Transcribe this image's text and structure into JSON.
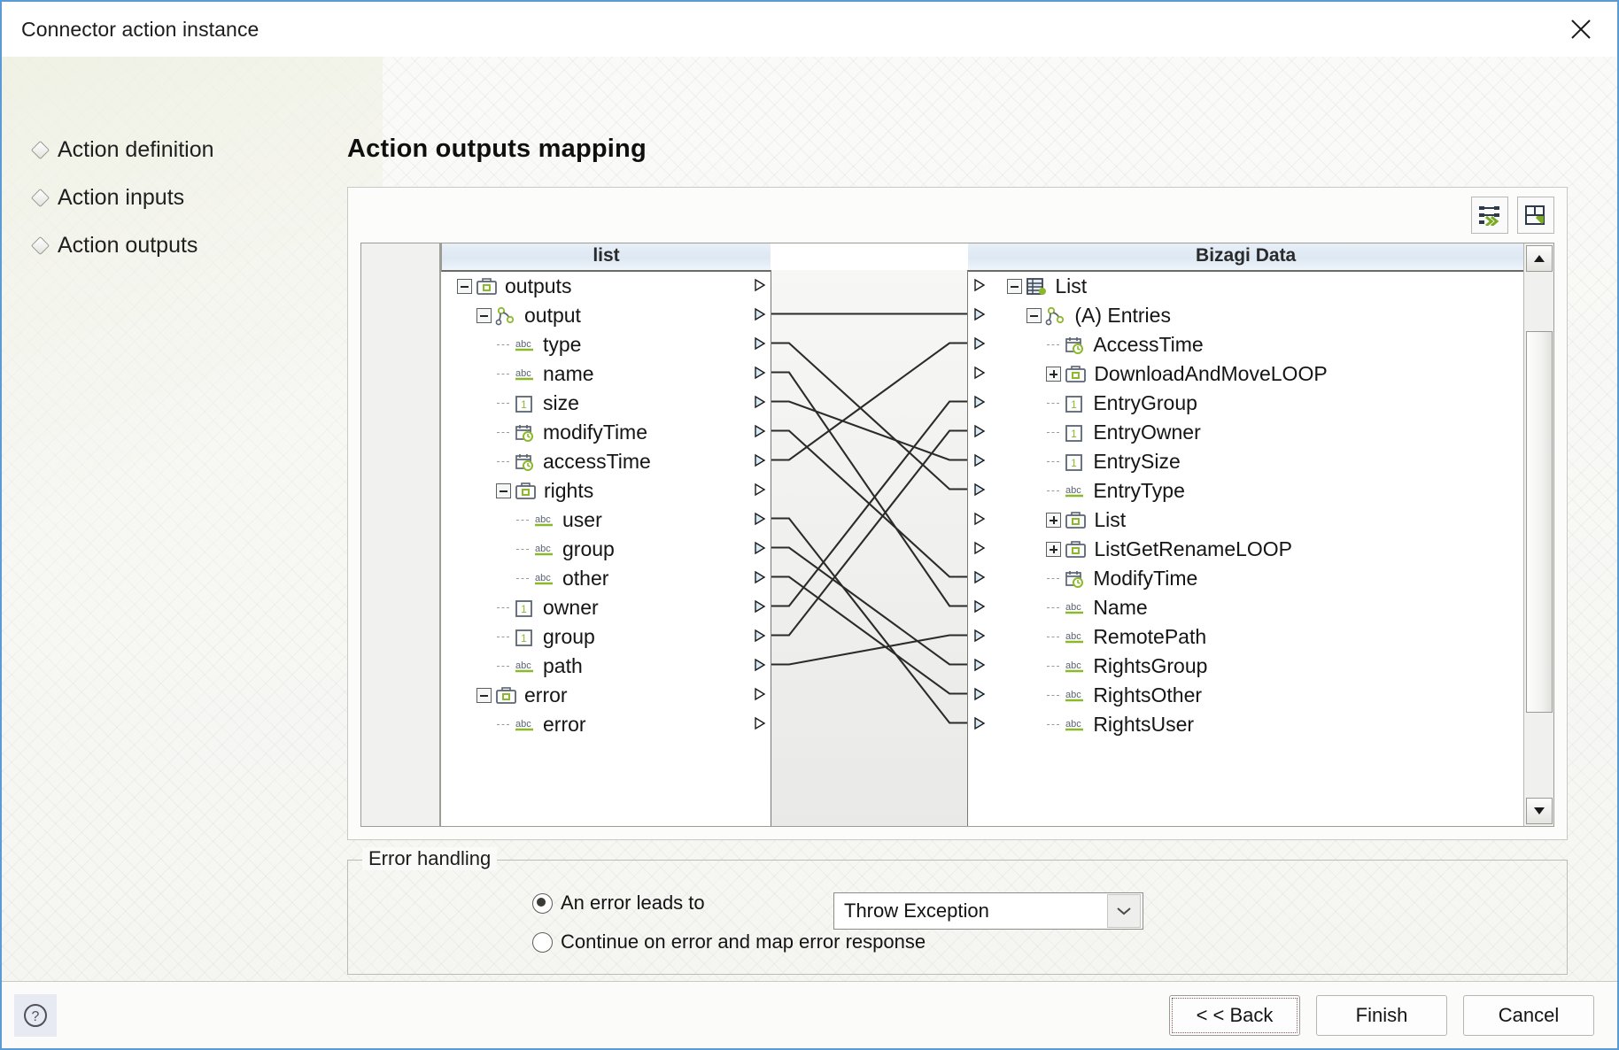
{
  "window": {
    "title": "Connector action instance",
    "close_icon": "close-icon"
  },
  "sidebar": {
    "items": [
      {
        "label": "Action definition"
      },
      {
        "label": "Action inputs"
      },
      {
        "label": "Action outputs"
      }
    ]
  },
  "main": {
    "page_title": "Action outputs mapping"
  },
  "mapper": {
    "toolbar": [
      {
        "name": "auto-map-button",
        "icon": "auto-map-icon"
      },
      {
        "name": "save-layout-button",
        "icon": "save-layout-icon"
      }
    ],
    "left_panel": {
      "header": "list",
      "rows": [
        {
          "label": "outputs",
          "indent": 0,
          "expander": "minus",
          "icon": "briefcase-icon",
          "connected": false
        },
        {
          "label": "output",
          "indent": 1,
          "expander": "minus",
          "icon": "node-icon",
          "connected": true
        },
        {
          "label": "type",
          "indent": 2,
          "expander": "dash",
          "icon": "abc-icon",
          "connected": true
        },
        {
          "label": "name",
          "indent": 2,
          "expander": "dash",
          "icon": "abc-icon",
          "connected": true
        },
        {
          "label": "size",
          "indent": 2,
          "expander": "dash",
          "icon": "number-icon",
          "connected": true
        },
        {
          "label": "modifyTime",
          "indent": 2,
          "expander": "dash",
          "icon": "datetime-icon",
          "connected": true
        },
        {
          "label": "accessTime",
          "indent": 2,
          "expander": "dash",
          "icon": "datetime-icon",
          "connected": true
        },
        {
          "label": "rights",
          "indent": 2,
          "expander": "minus",
          "icon": "briefcase-icon",
          "connected": false
        },
        {
          "label": "user",
          "indent": 3,
          "expander": "dash",
          "icon": "abc-icon",
          "connected": true
        },
        {
          "label": "group",
          "indent": 3,
          "expander": "dash",
          "icon": "abc-icon",
          "connected": true
        },
        {
          "label": "other",
          "indent": 3,
          "expander": "dash",
          "icon": "abc-icon",
          "connected": true
        },
        {
          "label": "owner",
          "indent": 2,
          "expander": "dash",
          "icon": "number-icon",
          "connected": true
        },
        {
          "label": "group",
          "indent": 2,
          "expander": "dash",
          "icon": "number-icon",
          "connected": true
        },
        {
          "label": "path",
          "indent": 2,
          "expander": "dash",
          "icon": "abc-icon",
          "connected": true
        },
        {
          "label": "error",
          "indent": 1,
          "expander": "minus",
          "icon": "briefcase-icon",
          "connected": false
        },
        {
          "label": "error",
          "indent": 2,
          "expander": "dash",
          "icon": "abc-icon",
          "connected": false
        }
      ]
    },
    "right_panel": {
      "header": "Bizagi Data",
      "rows": [
        {
          "label": "List",
          "indent": 0,
          "expander": "minus",
          "icon": "entity-icon",
          "connected": false
        },
        {
          "label": "(A) Entries",
          "indent": 1,
          "expander": "minus",
          "icon": "node-icon",
          "connected": true
        },
        {
          "label": "AccessTime",
          "indent": 2,
          "expander": "dash",
          "icon": "datetime-icon",
          "connected": true
        },
        {
          "label": "DownloadAndMoveLOOP",
          "indent": 2,
          "expander": "plus",
          "icon": "briefcase-icon",
          "connected": false
        },
        {
          "label": "EntryGroup",
          "indent": 2,
          "expander": "dash",
          "icon": "number-icon",
          "connected": true
        },
        {
          "label": "EntryOwner",
          "indent": 2,
          "expander": "dash",
          "icon": "number-icon",
          "connected": true
        },
        {
          "label": "EntrySize",
          "indent": 2,
          "expander": "dash",
          "icon": "number-icon",
          "connected": true
        },
        {
          "label": "EntryType",
          "indent": 2,
          "expander": "dash",
          "icon": "abc-icon",
          "connected": true
        },
        {
          "label": "List",
          "indent": 2,
          "expander": "plus",
          "icon": "briefcase-icon",
          "connected": false
        },
        {
          "label": "ListGetRenameLOOP",
          "indent": 2,
          "expander": "plus",
          "icon": "briefcase-icon",
          "connected": false
        },
        {
          "label": "ModifyTime",
          "indent": 2,
          "expander": "dash",
          "icon": "datetime-icon",
          "connected": true
        },
        {
          "label": "Name",
          "indent": 2,
          "expander": "dash",
          "icon": "abc-icon",
          "connected": true
        },
        {
          "label": "RemotePath",
          "indent": 2,
          "expander": "dash",
          "icon": "abc-icon",
          "connected": true
        },
        {
          "label": "RightsGroup",
          "indent": 2,
          "expander": "dash",
          "icon": "abc-icon",
          "connected": true
        },
        {
          "label": "RightsOther",
          "indent": 2,
          "expander": "dash",
          "icon": "abc-icon",
          "connected": true
        },
        {
          "label": "RightsUser",
          "indent": 2,
          "expander": "dash",
          "icon": "abc-icon",
          "connected": true
        }
      ]
    },
    "links": [
      {
        "from": 1,
        "to": 1
      },
      {
        "from": 2,
        "to": 7
      },
      {
        "from": 3,
        "to": 11
      },
      {
        "from": 4,
        "to": 6
      },
      {
        "from": 5,
        "to": 10
      },
      {
        "from": 6,
        "to": 2
      },
      {
        "from": 8,
        "to": 15
      },
      {
        "from": 9,
        "to": 13
      },
      {
        "from": 11,
        "to": 4
      },
      {
        "from": 12,
        "to": 5
      },
      {
        "from": 13,
        "to": 12
      },
      {
        "from": 10,
        "to": 14
      }
    ],
    "scrollbar": {
      "up_icon": "scroll-up-icon",
      "down_icon": "scroll-down-icon",
      "thumb_top_pct": 11,
      "thumb_height_pct": 73
    }
  },
  "error_handling": {
    "legend": "Error handling",
    "option_leads_to": "An error leads to",
    "option_continue": "Continue on error and map error response",
    "selected": "leads_to",
    "dropdown_value": "Throw Exception",
    "dropdown_icon": "chevron-down-icon"
  },
  "footer": {
    "help_icon": "help-icon",
    "back_label": "< < Back",
    "finish_label": "Finish",
    "cancel_label": "Cancel"
  },
  "colors": {
    "accent": "#5b9bd5",
    "icon_green": "#8cb82b",
    "icon_slate": "#5a6472"
  }
}
